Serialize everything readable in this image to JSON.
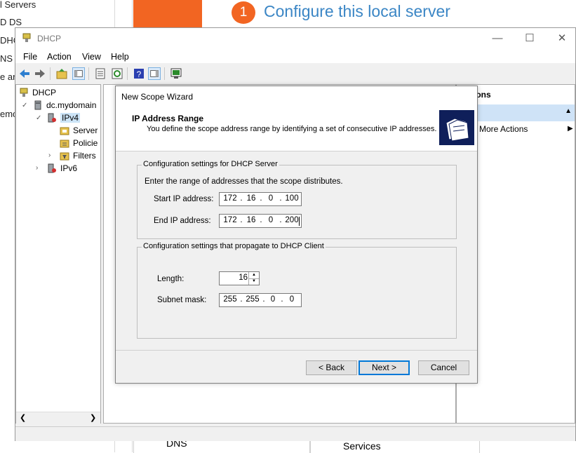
{
  "background": {
    "sidebar_items": [
      "l Servers",
      "D DS",
      "DHCP",
      "NS",
      "e ar",
      "emo"
    ],
    "step_number": "1",
    "step_title": "Configure this local server",
    "bottom_tile_1": "DNS",
    "bottom_tile_2": "Services"
  },
  "window": {
    "title": "DHCP",
    "menu": [
      "File",
      "Action",
      "View",
      "Help"
    ]
  },
  "tree": {
    "root": "DHCP",
    "server": "dc.mydomain",
    "ipv4": "IPv4",
    "children": [
      "Server",
      "Policie",
      "Filters"
    ],
    "ipv6": "IPv6"
  },
  "actions": {
    "header": "ions",
    "more_actions": "More Actions"
  },
  "wizard": {
    "title": "New Scope Wizard",
    "heading": "IP Address Range",
    "description": "You define the scope address range by identifying a set of consecutive IP addresses.",
    "group1_label": "Configuration settings for DHCP Server",
    "group1_instruction": "Enter the range of addresses that the scope distributes.",
    "start_label": "Start IP address:",
    "start_ip": [
      "172",
      "16",
      "0",
      "100"
    ],
    "end_label": "End IP address:",
    "end_ip": [
      "172",
      "16",
      "0",
      "200"
    ],
    "group2_label": "Configuration settings that propagate to DHCP Client",
    "length_label": "Length:",
    "length_value": "16",
    "mask_label": "Subnet mask:",
    "mask": [
      "255",
      "255",
      "0",
      "0"
    ],
    "back_button": "< Back",
    "next_button": "Next >",
    "cancel_button": "Cancel"
  }
}
